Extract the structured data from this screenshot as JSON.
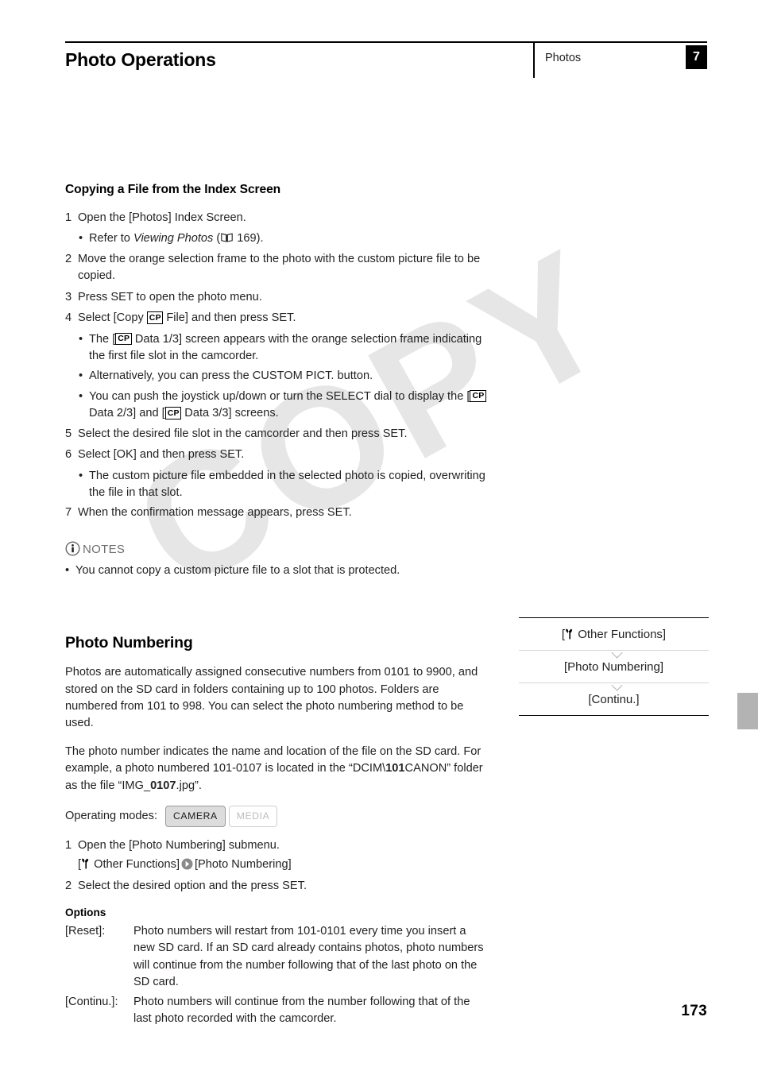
{
  "header": {
    "title": "Photo Operations",
    "section": "Photos",
    "chapter": "7"
  },
  "colors": {
    "text": "#231f20",
    "chapter_tab_bg": "#000000",
    "side_tab_gray": "#b3b3b3",
    "watermark": "#e6e6e6",
    "mode_on_bg": "#dcdcdc",
    "mode_off_text": "#bdbdbd"
  },
  "watermark": {
    "text": "COPY"
  },
  "subsection": {
    "heading": "Copying a File from the Index Screen",
    "steps": [
      {
        "num": "1",
        "text": "Open the [Photos] Index Screen."
      },
      {
        "num": "2",
        "text": "Move the orange selection frame to the photo with the custom picture file to be copied."
      },
      {
        "num": "3",
        "text": "Press SET to open the photo menu."
      },
      {
        "num": "4",
        "text_before": "Select [Copy ",
        "icon": "CP",
        "text_after": " File] and then press SET."
      },
      {
        "num": "5",
        "text": "Select the desired file slot in the camcorder and then press SET."
      },
      {
        "num": "6",
        "text": "Select [OK] and then press SET."
      },
      {
        "num": "7",
        "text": "When the confirmation message appears, press SET."
      }
    ],
    "bullet_step1": {
      "text_before": "Refer to ",
      "italic": "Viewing Photos",
      "text_after": " (",
      "page_ref": "169",
      "text_end": ")."
    },
    "bullets_step4": [
      {
        "before": "The [",
        "icon": "CP",
        "after": " Data 1/3] screen appears with the orange selection frame indicating the first file slot in the camcorder."
      },
      {
        "plain": "Alternatively, you can press the CUSTOM PICT. button."
      },
      {
        "before": "You can push the joystick up/down or turn the SELECT dial to display the [",
        "icon": "CP",
        "mid": " Data 2/3] and [",
        "icon2": "CP",
        "after": " Data 3/3] screens."
      }
    ],
    "bullet_step6": "The custom picture file embedded in the selected photo is copied, overwriting the file in that slot."
  },
  "notes": {
    "label": "NOTES",
    "items": [
      "You cannot copy a custom picture file to a slot that is protected."
    ]
  },
  "photo_numbering": {
    "heading": "Photo Numbering",
    "paragraph1": "Photos are automatically assigned consecutive numbers from 0101 to 9900, and stored on the SD card in folders containing up to 100 photos. Folders are numbered from 101 to 998. You can select the photo numbering method to be used.",
    "paragraph2": {
      "part1": "The photo number indicates the name and location of the file on the SD card. For example, a photo numbered 101-0107 is located in the “DCIM\\",
      "bold1": "101",
      "part2": "CANON” folder as the file “IMG_",
      "bold2": "0107",
      "part3": ".jpg”."
    },
    "operating_modes_label": "Operating modes:",
    "modes": [
      {
        "label": "CAMERA",
        "active": true
      },
      {
        "label": "MEDIA",
        "active": false
      }
    ],
    "steps": [
      {
        "num": "1",
        "text": "Open the [Photo Numbering] submenu."
      },
      {
        "num": "2",
        "text": "Select the desired option and the press SET."
      }
    ],
    "menu_path": {
      "item1": " Other Functions]",
      "open_bracket": "[",
      "item2": "[Photo Numbering]"
    },
    "options_title": "Options",
    "options": [
      {
        "key": "[Reset]:",
        "value": "Photo numbers will restart from 101-0101 every time you insert a new SD card. If an SD card already contains photos, photo numbers will continue from the number following that of the last photo on the SD card."
      },
      {
        "key": "[Continu.]:",
        "value": "Photo numbers will continue from the number following that of the last photo recorded with the camcorder."
      }
    ]
  },
  "menu_box": {
    "items": [
      {
        "bracket_open": "[",
        "label": " Other Functions]",
        "has_wrench": true
      },
      {
        "label": "[Photo Numbering]",
        "has_wrench": false
      },
      {
        "label": "[Continu.]",
        "has_wrench": false
      }
    ]
  },
  "page_number": "173"
}
